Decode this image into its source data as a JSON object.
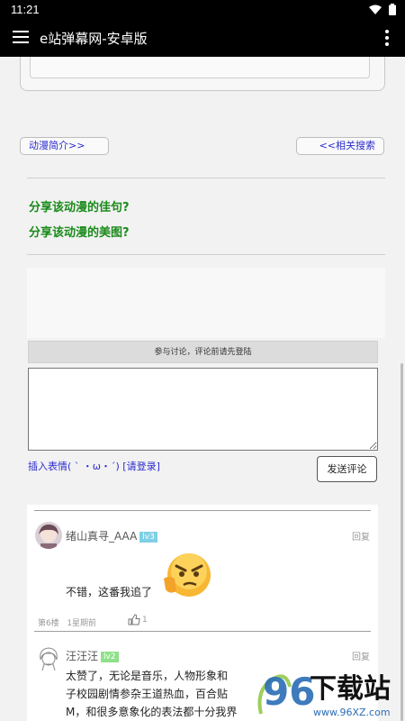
{
  "status": {
    "time": "11:21"
  },
  "appbar": {
    "title": "e站弹幕网-安卓版"
  },
  "nav": {
    "intro_label": "动漫简介>>",
    "search_label": "<<相关搜索"
  },
  "share": {
    "quote_label": "分享该动漫的佳句?",
    "image_label": "分享该动漫的美图?"
  },
  "comment_form": {
    "login_hint": "参与讨论，评论前请先登陆",
    "textarea_value": "",
    "emoji_link": "插入表情( ` ・ω・´)",
    "login_link": "[请登录]",
    "send_label": "发送评论"
  },
  "comments": [
    {
      "username": "绪山真寻_AAA",
      "level": "lv3",
      "level_color": "#7fd0e6",
      "reply": "回复",
      "text": "不错，这番我追了",
      "floor": "第6楼",
      "time": "1星期前",
      "likes": "1"
    },
    {
      "username": "汪汪汪",
      "level": "lv2",
      "level_color": "#8fe08a",
      "reply": "回复",
      "text_lines": [
        "太赞了，无论是音乐，人物形象和",
        "子校园剧情参杂王道热血，百合贴",
        "M，和很多意象化的表法都十分我界"
      ]
    }
  ],
  "watermark": {
    "number": "96",
    "text": "下载站",
    "url": "www.96XZ.com"
  }
}
